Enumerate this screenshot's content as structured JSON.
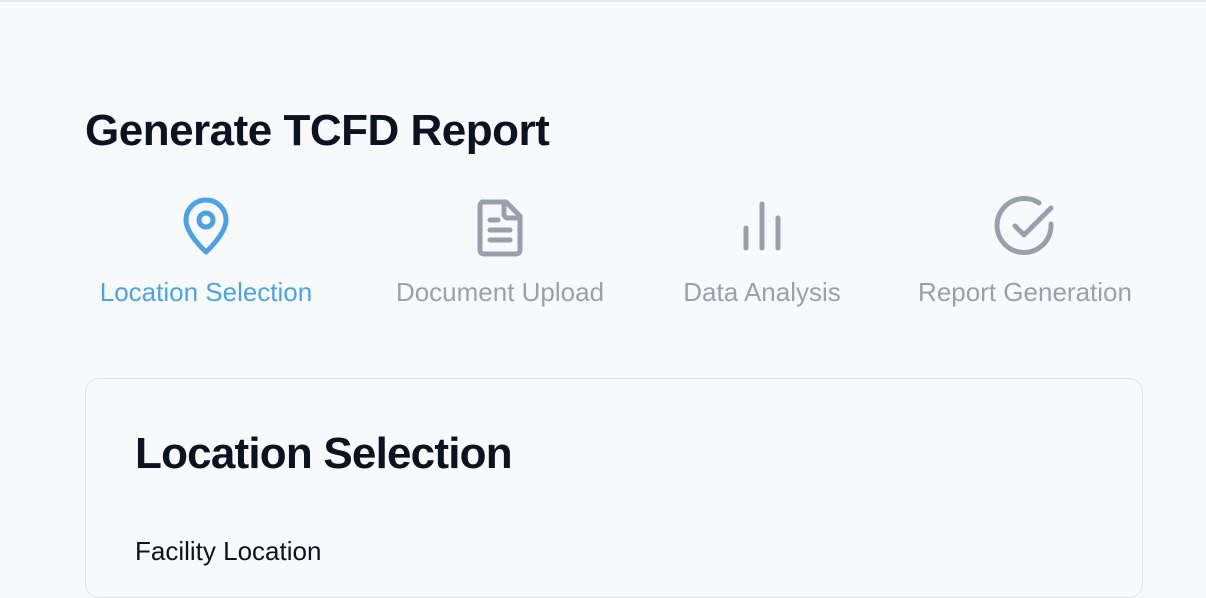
{
  "page": {
    "title": "Generate TCFD Report"
  },
  "steps": [
    {
      "label": "Location Selection",
      "icon": "map-pin-icon",
      "active": true
    },
    {
      "label": "Document Upload",
      "icon": "document-icon",
      "active": false
    },
    {
      "label": "Data Analysis",
      "icon": "bar-chart-icon",
      "active": false
    },
    {
      "label": "Report Generation",
      "icon": "check-circle-icon",
      "active": false
    }
  ],
  "card": {
    "title": "Location Selection",
    "field_label": "Facility Location"
  },
  "colors": {
    "active": "#4da3e0",
    "inactive": "#9aa0ab",
    "text": "#0b1220",
    "background": "#f8f9fb"
  }
}
